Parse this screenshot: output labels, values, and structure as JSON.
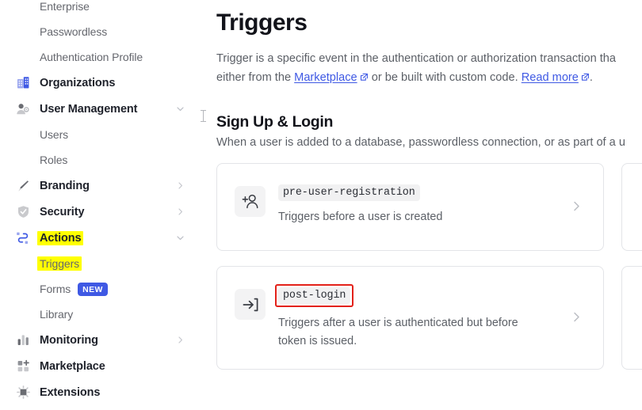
{
  "sidebar": {
    "items": [
      {
        "label": "Enterprise",
        "type": "sub",
        "icon": "",
        "chevron": "",
        "highlight": false,
        "clipped": true
      },
      {
        "label": "Passwordless",
        "type": "sub",
        "icon": "",
        "chevron": "",
        "highlight": false
      },
      {
        "label": "Authentication Profile",
        "type": "sub",
        "icon": "",
        "chevron": "",
        "highlight": false
      },
      {
        "label": "Organizations",
        "type": "top",
        "icon": "organizations-icon",
        "chevron": "",
        "highlight": false
      },
      {
        "label": "User Management",
        "type": "top",
        "icon": "user-management-icon",
        "chevron": "down",
        "highlight": false
      },
      {
        "label": "Users",
        "type": "sub",
        "icon": "",
        "chevron": "",
        "highlight": false
      },
      {
        "label": "Roles",
        "type": "sub",
        "icon": "",
        "chevron": "",
        "highlight": false
      },
      {
        "label": "Branding",
        "type": "top",
        "icon": "branding-icon",
        "chevron": "right",
        "highlight": false
      },
      {
        "label": "Security",
        "type": "top",
        "icon": "security-icon",
        "chevron": "right",
        "highlight": false
      },
      {
        "label": "Actions",
        "type": "top",
        "icon": "actions-icon",
        "chevron": "down",
        "highlight": true
      },
      {
        "label": "Triggers",
        "type": "sub",
        "icon": "",
        "chevron": "",
        "highlight": true
      },
      {
        "label": "Forms",
        "type": "sub",
        "icon": "",
        "chevron": "",
        "highlight": false,
        "badge": "NEW"
      },
      {
        "label": "Library",
        "type": "sub",
        "icon": "",
        "chevron": "",
        "highlight": false
      },
      {
        "label": "Monitoring",
        "type": "top",
        "icon": "monitoring-icon",
        "chevron": "right",
        "highlight": false
      },
      {
        "label": "Marketplace",
        "type": "top",
        "icon": "marketplace-icon",
        "chevron": "",
        "highlight": false
      },
      {
        "label": "Extensions",
        "type": "top",
        "icon": "extensions-icon",
        "chevron": "",
        "highlight": false
      }
    ]
  },
  "main": {
    "title": "Triggers",
    "description_line1": "Trigger is a specific event in the authentication or authorization transaction tha",
    "description_line2_a": "either from the ",
    "description_line2_link1": "Marketplace",
    "description_line2_b": " or be built with custom code. ",
    "description_line2_link2": "Read more",
    "description_line2_c": ".",
    "section_title": "Sign Up & Login",
    "section_subtitle": "When a user is added to a database, passwordless connection, or as part of a u",
    "cards": [
      {
        "code": "pre-user-registration",
        "desc": "Triggers before a user is created",
        "icon": "person-add-icon",
        "boxed": false
      },
      {
        "code": "post-login",
        "desc": "Triggers after a user is authenticated but before token is issued.",
        "icon": "login-arrow-icon",
        "boxed": true
      }
    ]
  },
  "colors": {
    "accent": "#3f59e4",
    "highlight": "#ffff00",
    "annotation_box": "#e32119",
    "text_primary": "#12131a",
    "text_secondary": "#5c6067",
    "card_border": "#e3e4e8"
  }
}
